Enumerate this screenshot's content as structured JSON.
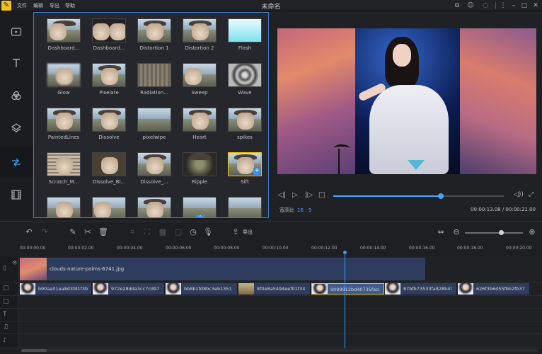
{
  "app": {
    "title": "未命名",
    "menu": [
      "文件",
      "编辑",
      "导出",
      "帮助"
    ]
  },
  "effects": [
    {
      "label": "Dashboard..."
    },
    {
      "label": "Dashboard..."
    },
    {
      "label": "Distortion 1"
    },
    {
      "label": "Distortion 2"
    },
    {
      "label": "Flash"
    },
    {
      "label": "Glow"
    },
    {
      "label": "Pixelate"
    },
    {
      "label": "Radiation..."
    },
    {
      "label": "Sweep"
    },
    {
      "label": "Wave"
    },
    {
      "label": "PaintedLines"
    },
    {
      "label": "Dissolve"
    },
    {
      "label": "pixelwipe"
    },
    {
      "label": "Heart"
    },
    {
      "label": "spikes"
    },
    {
      "label": "Scratch_M..."
    },
    {
      "label": "Dissolve_Bl..."
    },
    {
      "label": "Dissolve_..."
    },
    {
      "label": "Ripple"
    },
    {
      "label": "Sift"
    }
  ],
  "preview": {
    "ratio_label": "宽高比",
    "ratio_value": "16 : 9",
    "time": "00:00:13.08 / 00:00:21.00",
    "progress_fraction": 0.63
  },
  "toolbar": {
    "export_label": "导出"
  },
  "ruler": [
    "00:00:00.00",
    "00:00:02.00",
    "00:00:04.00",
    "00:00:06.00",
    "00:00:08.00",
    "00:00:10.00",
    "00:00:12.00",
    "00:00:14.00",
    "00:00:16.00",
    "00:00:18.00",
    "00:00:20.00"
  ],
  "timeline": {
    "bg_clip": "clouds-nature-palms-6741.jpg",
    "clips": [
      {
        "name": "b90aa01ea8d3fd1f3b"
      },
      {
        "name": "972e28dda3cc7cd97"
      },
      {
        "name": "bb8b1fd8bc3eb1351"
      },
      {
        "name": "8f0e8a5494eef01f34"
      },
      {
        "name": "9099912bd40735faci"
      },
      {
        "name": "87bfb73533fa828b4l"
      },
      {
        "name": "626f3b6d55fbb2fb37"
      }
    ]
  },
  "colors": {
    "accent": "#3a9bff",
    "selected": "#f0c419",
    "logo": "#f3c11b"
  }
}
